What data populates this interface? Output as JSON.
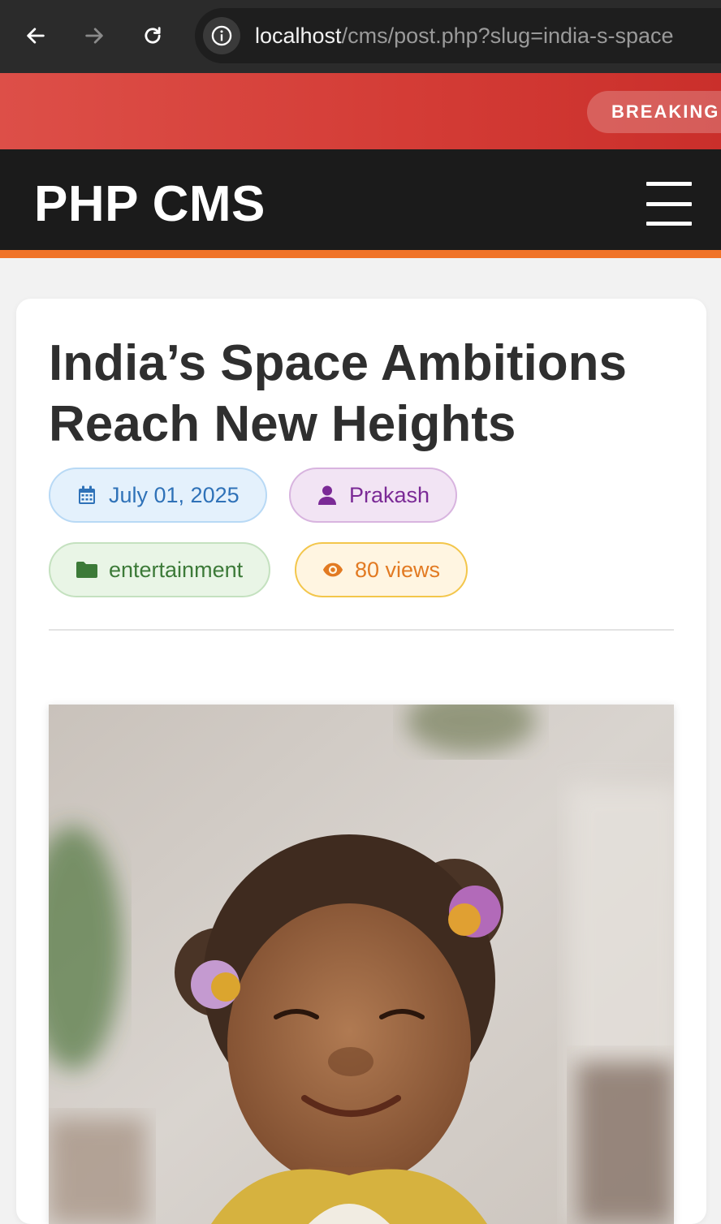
{
  "browser": {
    "url_host": "localhost",
    "url_path": "/cms/post.php?slug=india-s-space"
  },
  "breaking": {
    "label": "BREAKING"
  },
  "header": {
    "logo": "PHP CMS"
  },
  "post": {
    "title": "India’s Space Ambitions Reach New Heights",
    "date": "July 01, 2025",
    "author": "Prakash",
    "category": "entertainment",
    "views": "80 views"
  },
  "colors": {
    "breaking_red": "#d33b35",
    "header_dark": "#1b1b1b",
    "accent_orange": "#f07328",
    "date_blue": "#2f72b8",
    "author_purple": "#7b2a96",
    "category_green": "#3c7a38",
    "views_orange": "#e27a22"
  },
  "icons": {
    "back": "arrow-left-icon",
    "forward": "arrow-right-icon",
    "reload": "reload-icon",
    "site_info": "info-icon",
    "menu": "hamburger-icon",
    "date": "calendar-icon",
    "author": "user-icon",
    "category": "folder-icon",
    "views": "eye-icon"
  }
}
